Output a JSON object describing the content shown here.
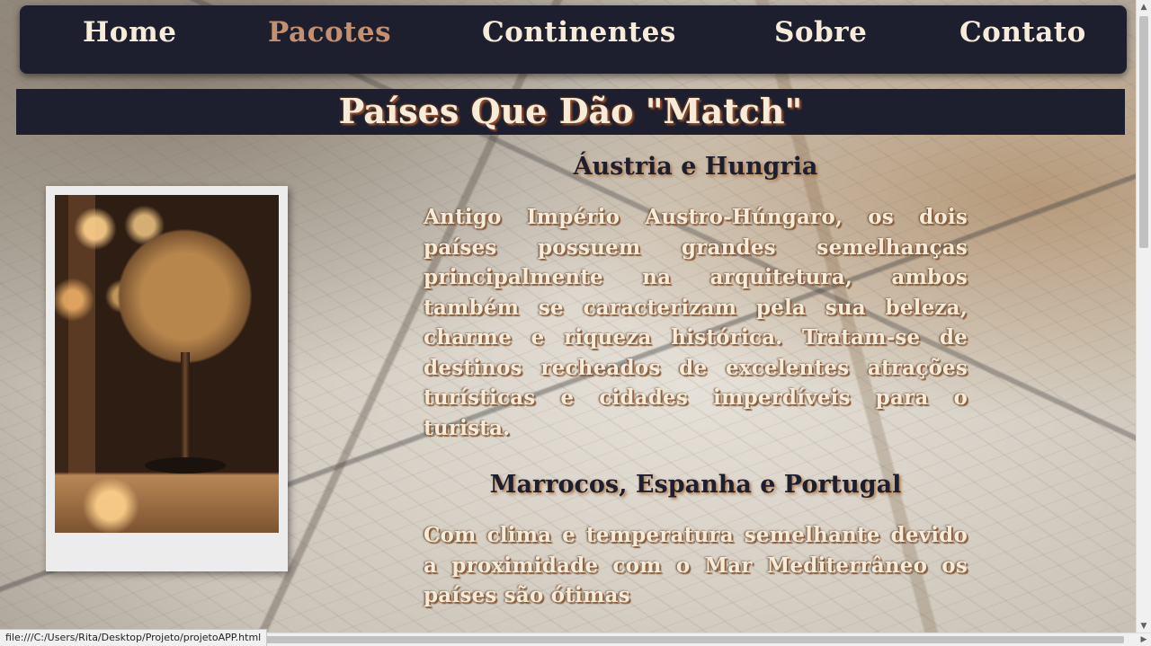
{
  "nav": {
    "items": [
      {
        "label": "Home",
        "active": false
      },
      {
        "label": "Pacotes",
        "active": true
      },
      {
        "label": "Continentes",
        "active": false
      },
      {
        "label": "Sobre",
        "active": false
      },
      {
        "label": "Contato",
        "active": false
      }
    ]
  },
  "page": {
    "title": "Países Que Dão \"Match\""
  },
  "sections": [
    {
      "heading": "Áustria e Hungria",
      "text": "Antigo Império Austro-Húngaro, os dois países possuem grandes semelhanças principalmente na arquitetura, ambos também se caracterizam pela sua beleza, charme e riqueza histórica. Tratam-se de destinos recheados de excelentes atrações turísticas e cidades imperdíveis para o turista."
    },
    {
      "heading": "Marrocos, Espanha e Portugal",
      "text": "Com clima e temperatura semelhante devido a proximidade com o Mar Mediterrâneo os países são ótimas"
    }
  ],
  "status": {
    "url": "file:///C:/Users/Rita/Desktop/Projeto/projetoAPP.html"
  },
  "colors": {
    "nav_background": "#1e1f2e",
    "nav_text": "#f7ecd9",
    "nav_active": "#c4906f",
    "heading_text": "#1e1f2e"
  },
  "icons": {
    "scroll_up": "triangle-up-icon",
    "scroll_down": "triangle-down-icon",
    "scroll_left": "triangle-left-icon",
    "scroll_right": "triangle-right-icon"
  }
}
